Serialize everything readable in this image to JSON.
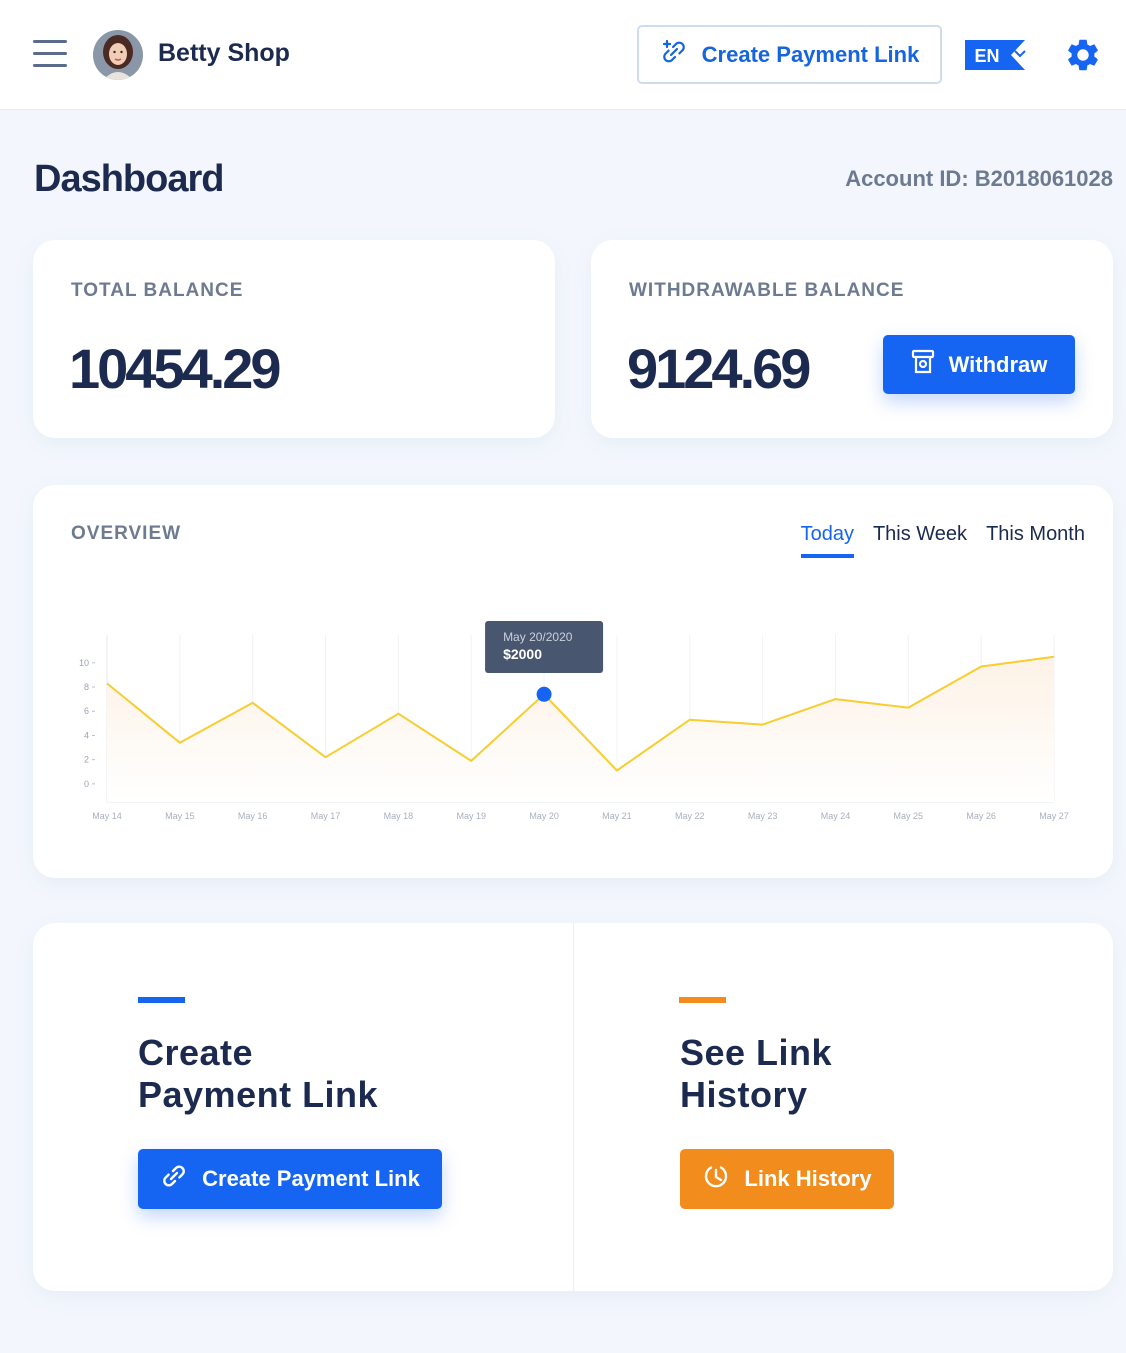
{
  "header": {
    "shop_name": "Betty Shop",
    "create_payment_link_label": "Create Payment Link",
    "language": "EN",
    "icons": [
      "menu-icon",
      "avatar",
      "link-plus-icon",
      "chevron-down-icon",
      "gear-icon"
    ]
  },
  "page": {
    "title": "Dashboard",
    "account_id": "Account ID: B2018061028"
  },
  "balances": {
    "total_label": "TOTAL BALANCE",
    "total_value": "10454.29",
    "withdrawable_label": "WITHDRAWABLE BALANCE",
    "withdrawable_value": "9124.69",
    "withdraw_label": "Withdraw"
  },
  "overview": {
    "label": "OVERVIEW",
    "tabs": [
      {
        "label": "Today",
        "active": true
      },
      {
        "label": "This Week",
        "active": false
      },
      {
        "label": "This Month",
        "active": false
      }
    ],
    "tooltip": {
      "date": "May 20/2020",
      "value": "$2000"
    }
  },
  "chart_data": {
    "type": "area",
    "categories": [
      "May 14",
      "May 15",
      "May 16",
      "May 17",
      "May 18",
      "May 19",
      "May 20",
      "May 21",
      "May 22",
      "May 23",
      "May 24",
      "May 25",
      "May 26",
      "May 27"
    ],
    "values": [
      8.3,
      3.4,
      6.7,
      2.2,
      5.8,
      1.9,
      7.4,
      1.1,
      5.3,
      4.9,
      7.0,
      6.3,
      9.7,
      10.5
    ],
    "yticks": [
      0,
      2,
      4,
      6,
      8,
      10
    ],
    "ylim": [
      -1.5,
      12.3
    ],
    "highlight_index": 6,
    "colors": {
      "line": "#f7cd2f",
      "fill": "#fdf2e6",
      "point": "#1665f2"
    }
  },
  "actions": {
    "create": {
      "title_line1": "Create",
      "title_line2": "Payment Link",
      "button_label": "Create Payment Link",
      "accent": "#1665f2"
    },
    "history": {
      "title_line1": "See Link",
      "title_line2": "History",
      "button_label": "Link History",
      "accent": "#f28c1c"
    }
  }
}
